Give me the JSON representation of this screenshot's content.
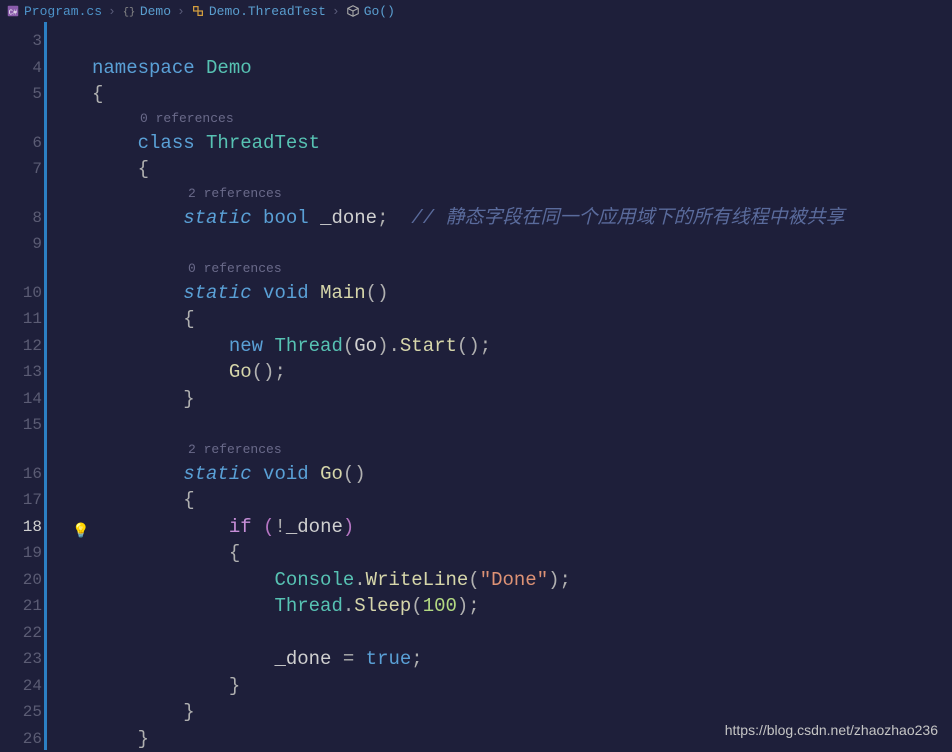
{
  "breadcrumb": {
    "file": "Program.cs",
    "ns": "Demo",
    "cls": "Demo.ThreadTest",
    "method": "Go()"
  },
  "gutter": [
    "3",
    "4",
    "5",
    "6",
    "7",
    "8",
    "9",
    "10",
    "11",
    "12",
    "13",
    "14",
    "15",
    "16",
    "17",
    "18",
    "19",
    "20",
    "21",
    "22",
    "23",
    "24",
    "25",
    "26"
  ],
  "reflens": {
    "class": "0 references",
    "done": "2 references",
    "main": "0 references",
    "go": "2 references"
  },
  "code": {
    "namespace": "namespace",
    "demo": "Demo",
    "class_kw": "class",
    "threadtest": "ThreadTest",
    "static_kw": "static",
    "bool_kw": "bool",
    "done_field": "_done",
    "done_comment": "// 静态字段在同一个应用域下的所有线程中被共享",
    "void_kw": "void",
    "main_name": "Main",
    "new_kw": "new",
    "thread_type": "Thread",
    "go_name": "Go",
    "start_name": "Start",
    "if_kw": "if",
    "console": "Console",
    "writeline": "WriteLine",
    "done_str": "\"Done\"",
    "sleep": "Sleep",
    "sleep_ms": "100",
    "eq": "=",
    "true_kw": "true"
  },
  "watermark": "https://blog.csdn.net/zhaozhao236",
  "highlighted_line": 18
}
